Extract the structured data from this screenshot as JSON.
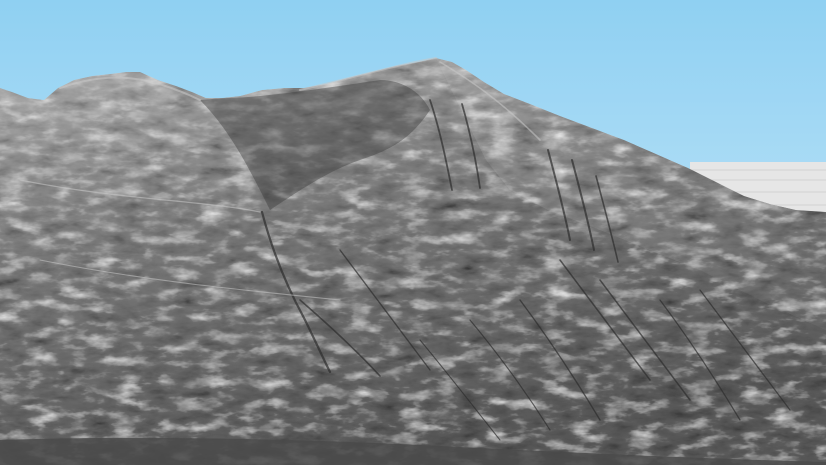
{
  "scene": {
    "subject": "shaded-relief-terrain",
    "colors": {
      "sky_top": "#8fd0f2",
      "sky_bottom": "#d6eefa",
      "ground_plane": "#e6e6e6",
      "ground_line": "#cfcfcf",
      "rock_light": "#b0b0b0",
      "rock_mid": "#7a7a7a",
      "rock_dark": "#3c3c3c",
      "foreground": "#4a4a4a"
    }
  }
}
